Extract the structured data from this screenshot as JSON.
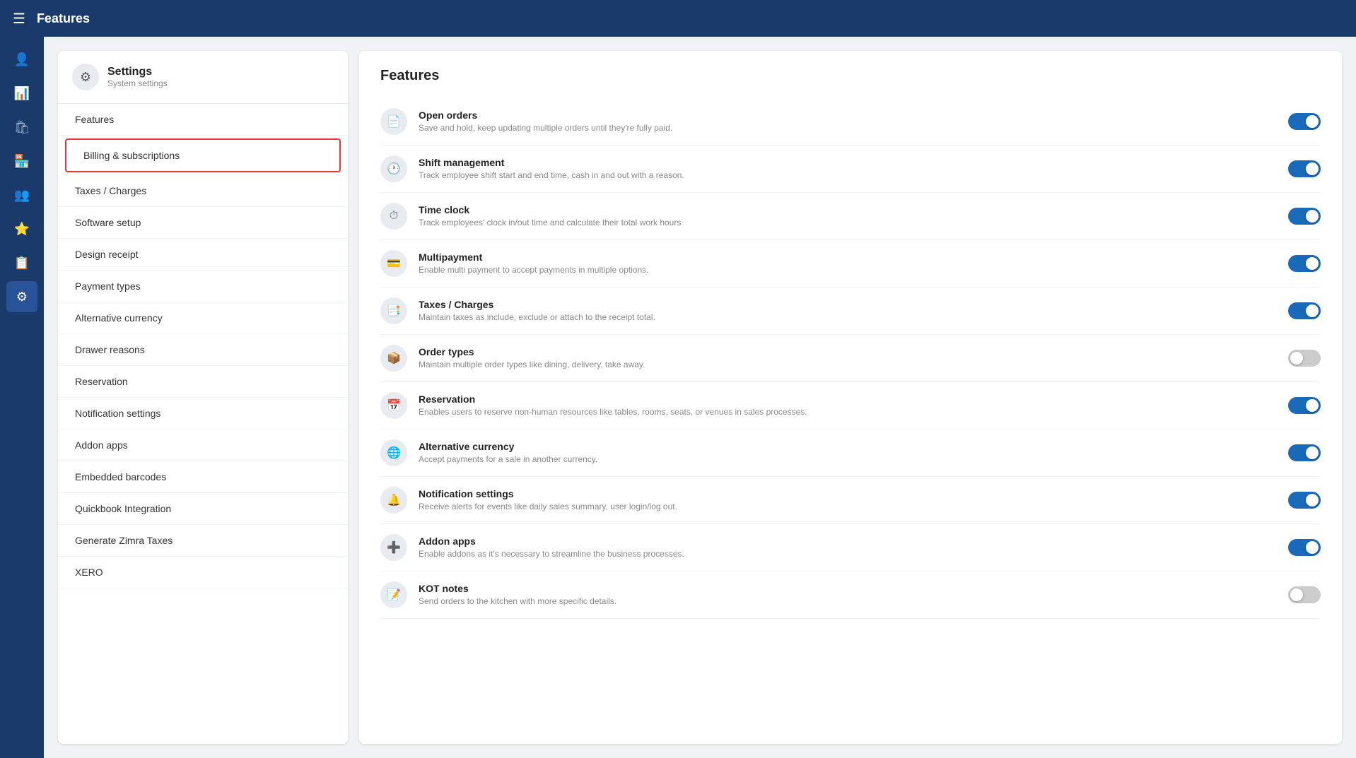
{
  "topbar": {
    "title": "Features",
    "menu_icon": "☰"
  },
  "sidebar_icons": [
    {
      "name": "user-icon",
      "symbol": "👤",
      "active": false,
      "label": "User"
    },
    {
      "name": "chart-icon",
      "symbol": "📊",
      "active": false,
      "label": "Analytics"
    },
    {
      "name": "bag-icon",
      "symbol": "🛍",
      "active": false,
      "label": "Products"
    },
    {
      "name": "warehouse-icon",
      "symbol": "🏪",
      "active": false,
      "label": "Warehouse"
    },
    {
      "name": "people-icon",
      "symbol": "👥",
      "active": false,
      "label": "People"
    },
    {
      "name": "star-icon",
      "symbol": "⭐",
      "active": false,
      "label": "Star"
    },
    {
      "name": "report-icon",
      "symbol": "📋",
      "active": false,
      "label": "Reports"
    },
    {
      "name": "features-icon",
      "symbol": "⚙",
      "active": true,
      "label": "Features"
    }
  ],
  "settings": {
    "header_title": "Settings",
    "header_subtitle": "System settings",
    "nav_items": [
      {
        "id": "features",
        "label": "Features",
        "highlighted": false
      },
      {
        "id": "billing",
        "label": "Billing & subscriptions",
        "highlighted": true
      },
      {
        "id": "taxes",
        "label": "Taxes / Charges",
        "highlighted": false
      },
      {
        "id": "software-setup",
        "label": "Software setup",
        "highlighted": false
      },
      {
        "id": "design-receipt",
        "label": "Design receipt",
        "highlighted": false
      },
      {
        "id": "payment-types",
        "label": "Payment types",
        "highlighted": false
      },
      {
        "id": "alternative-currency",
        "label": "Alternative currency",
        "highlighted": false
      },
      {
        "id": "drawer-reasons",
        "label": "Drawer reasons",
        "highlighted": false
      },
      {
        "id": "reservation",
        "label": "Reservation",
        "highlighted": false
      },
      {
        "id": "notification-settings",
        "label": "Notification settings",
        "highlighted": false
      },
      {
        "id": "addon-apps",
        "label": "Addon apps",
        "highlighted": false
      },
      {
        "id": "embedded-barcodes",
        "label": "Embedded barcodes",
        "highlighted": false
      },
      {
        "id": "quickbook",
        "label": "Quickbook Integration",
        "highlighted": false
      },
      {
        "id": "zimra",
        "label": "Generate Zimra Taxes",
        "highlighted": false
      },
      {
        "id": "xero",
        "label": "XERO",
        "highlighted": false
      }
    ]
  },
  "features": {
    "title": "Features",
    "items": [
      {
        "id": "open-orders",
        "name": "Open orders",
        "desc": "Save and hold, keep updating multiple orders until they're fully paid.",
        "icon": "📄",
        "enabled": true
      },
      {
        "id": "shift-management",
        "name": "Shift management",
        "desc": "Track employee shift start and end time, cash in and out with a reason.",
        "icon": "🕐",
        "enabled": true
      },
      {
        "id": "time-clock",
        "name": "Time clock",
        "desc": "Track employees' clock in/out time and calculate their total work hours",
        "icon": "⏱",
        "enabled": true
      },
      {
        "id": "multipayment",
        "name": "Multipayment",
        "desc": "Enable multi payment to accept payments in multiple options.",
        "icon": "💳",
        "enabled": true
      },
      {
        "id": "taxes-charges",
        "name": "Taxes / Charges",
        "desc": "Maintain taxes as include, exclude or attach to the receipt total.",
        "icon": "📑",
        "enabled": true
      },
      {
        "id": "order-types",
        "name": "Order types",
        "desc": "Maintain multiple order types like dining, delivery, take away.",
        "icon": "📦",
        "enabled": false
      },
      {
        "id": "reservation",
        "name": "Reservation",
        "desc": "Enables users to reserve non-human resources like tables, rooms, seats, or venues in sales processes.",
        "icon": "📅",
        "enabled": true
      },
      {
        "id": "alternative-currency",
        "name": "Alternative currency",
        "desc": "Accept payments for a sale in another currency.",
        "icon": "🌐",
        "enabled": true
      },
      {
        "id": "notification-settings",
        "name": "Notification settings",
        "desc": "Receive alerts for events like daily sales summary, user login/log out.",
        "icon": "🔔",
        "enabled": true
      },
      {
        "id": "addon-apps",
        "name": "Addon apps",
        "desc": "Enable addons as it's necessary to streamline the business processes.",
        "icon": "➕",
        "enabled": true
      },
      {
        "id": "kot-notes",
        "name": "KOT notes",
        "desc": "Send orders to the kitchen with more specific details.",
        "icon": "📝",
        "enabled": false
      }
    ]
  }
}
